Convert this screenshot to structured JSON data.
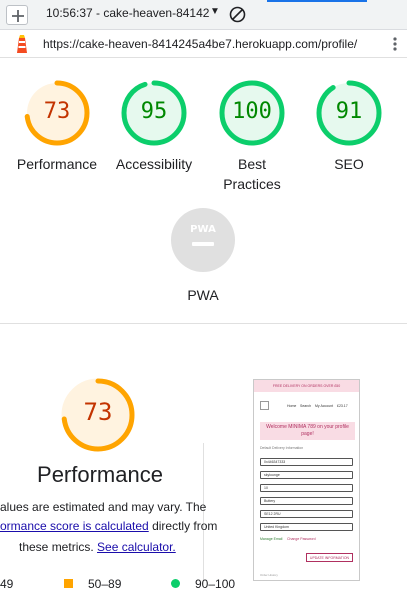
{
  "toolbar": {
    "report_select": "10:56:37 - cake-heaven-84142",
    "new_tab_icon": "plus-icon",
    "clear_icon": "block-icon"
  },
  "urlbar": {
    "url": "https://cake-heaven-8414245a4be7.herokuapp.com/profile/",
    "logo_icon": "lighthouse-icon",
    "menu_icon": "kebab-menu-icon"
  },
  "gauges": [
    {
      "label": "Performance",
      "score": "73",
      "value": 73,
      "color": "#ffa400",
      "text_color": "#c33300",
      "fill": "#fff3e0"
    },
    {
      "label": "Accessibility",
      "score": "95",
      "value": 95,
      "color": "#0cce6b",
      "text_color": "#008800",
      "fill": "#e6f9ee"
    },
    {
      "label": "Best\nPractices",
      "score": "100",
      "value": 100,
      "color": "#0cce6b",
      "text_color": "#008800",
      "fill": "#e6f9ee"
    },
    {
      "label": "SEO",
      "score": "91",
      "value": 91,
      "color": "#0cce6b",
      "text_color": "#008800",
      "fill": "#e6f9ee"
    }
  ],
  "pwa": {
    "label": "PWA",
    "badge_text": "PWA"
  },
  "performance_detail": {
    "score": "73",
    "value": 73,
    "title": "Performance",
    "line1": "alues are estimated and may vary. The",
    "line2_link": "ormance score is calculated",
    "line2_rest": " directly from",
    "line3_prefix": "these metrics. ",
    "line3_link": "See calculator.",
    "legend": [
      {
        "label": "49"
      },
      {
        "label": "50–89",
        "color": "#ffa400",
        "shape": "square"
      },
      {
        "label": "90–100",
        "color": "#0cce6b",
        "shape": "circle"
      }
    ]
  },
  "thumbnail": {
    "banner": "FREE DELIVERY ON ORDERS OVER £50",
    "nav": [
      "Home",
      "Search",
      "My Account",
      "£23.17"
    ],
    "welcome": "Welcome MINIMA 789 on your profile page!",
    "section_label": "Default Delivery Information",
    "fields": [
      "0x446347333",
      "skylounge",
      "10",
      "Buttery",
      "SE12 2RU",
      "United Kingdom"
    ],
    "link_manage": "Manage Email",
    "link_change": "Change Password",
    "button": "UPDATE INFORMATION",
    "footer": "Order History"
  }
}
